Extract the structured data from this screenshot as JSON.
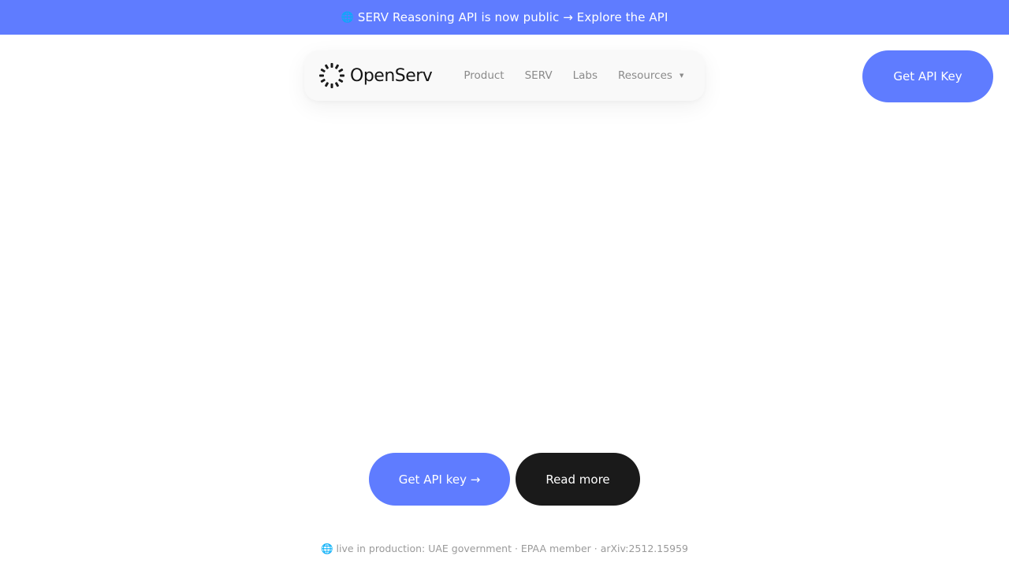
{
  "banner": {
    "icon": "globe-icon",
    "text": "SERV Reasoning API is now public → Explore the API",
    "background": "#5f7cff"
  },
  "nav": {
    "brand": "OpenServ",
    "logo_icon": "openserv-logo-icon",
    "links": [
      {
        "label": "Product"
      },
      {
        "label": "SERV"
      },
      {
        "label": "Labs"
      },
      {
        "label": "Resources",
        "has_dropdown": true
      }
    ],
    "cta_label": "Get API Key"
  },
  "hero": {
    "primary_label": "Get API key →",
    "secondary_label": "Read more"
  },
  "footer": {
    "note": "live in production: UAE government · EPAA member · arXiv:2512.15959",
    "icon": "globe-icon"
  },
  "colors": {
    "accent": "#5f7cff",
    "dark": "#1a1a1a",
    "muted_text": "#8a8a8a"
  }
}
